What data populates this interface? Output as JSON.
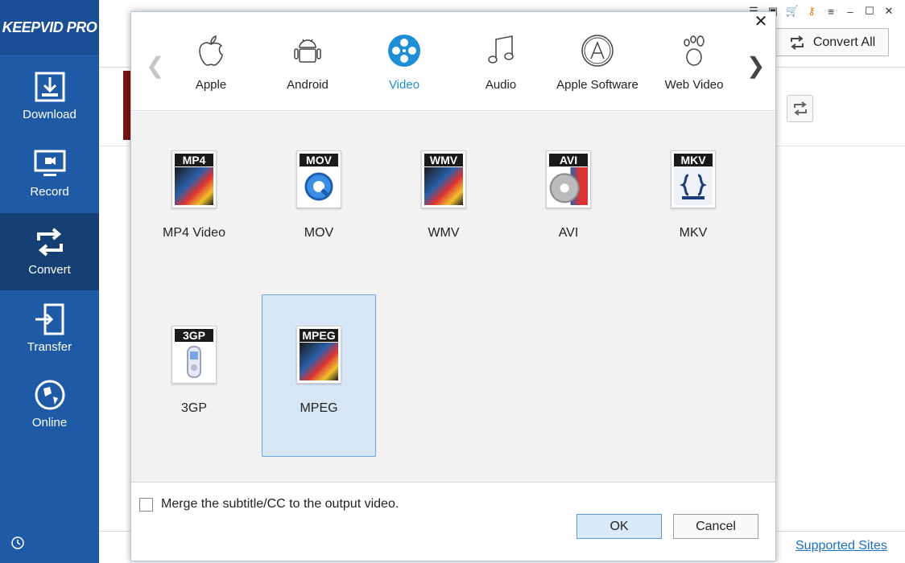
{
  "app": {
    "logo": "KEEPVID PRO"
  },
  "sidebar": {
    "items": [
      {
        "label": "Download",
        "icon": "download-icon"
      },
      {
        "label": "Record",
        "icon": "record-icon"
      },
      {
        "label": "Convert",
        "icon": "convert-icon",
        "active": true
      },
      {
        "label": "Transfer",
        "icon": "transfer-icon"
      },
      {
        "label": "Online",
        "icon": "online-icon"
      }
    ]
  },
  "toolbar": {
    "convert_all_label": "Convert All"
  },
  "footer": {
    "supported_sites": "Supported Sites"
  },
  "dialog": {
    "categories": [
      {
        "label": "Apple",
        "icon": "apple-icon"
      },
      {
        "label": "Android",
        "icon": "android-icon"
      },
      {
        "label": "Video",
        "icon": "video-reel-icon",
        "active": true
      },
      {
        "label": "Audio",
        "icon": "music-note-icon"
      },
      {
        "label": "Apple Software",
        "icon": "app-store-icon"
      },
      {
        "label": "Web Video",
        "icon": "gnome-foot-icon"
      }
    ],
    "formats": [
      {
        "tag": "MP4",
        "label": "MP4 Video"
      },
      {
        "tag": "MOV",
        "label": "MOV"
      },
      {
        "tag": "WMV",
        "label": "WMV"
      },
      {
        "tag": "AVI",
        "label": "AVI"
      },
      {
        "tag": "MKV",
        "label": "MKV"
      },
      {
        "tag": "3GP",
        "label": "3GP"
      },
      {
        "tag": "MPEG",
        "label": "MPEG",
        "selected": true
      }
    ],
    "merge_label": "Merge the subtitle/CC to the output video.",
    "merge_checked": false,
    "ok_label": "OK",
    "cancel_label": "Cancel"
  },
  "colors": {
    "sidebar": "#1f5aa6",
    "sidebar_active": "#163f73",
    "accent": "#1e8fd6",
    "selected_bg": "#d6e6f5"
  }
}
